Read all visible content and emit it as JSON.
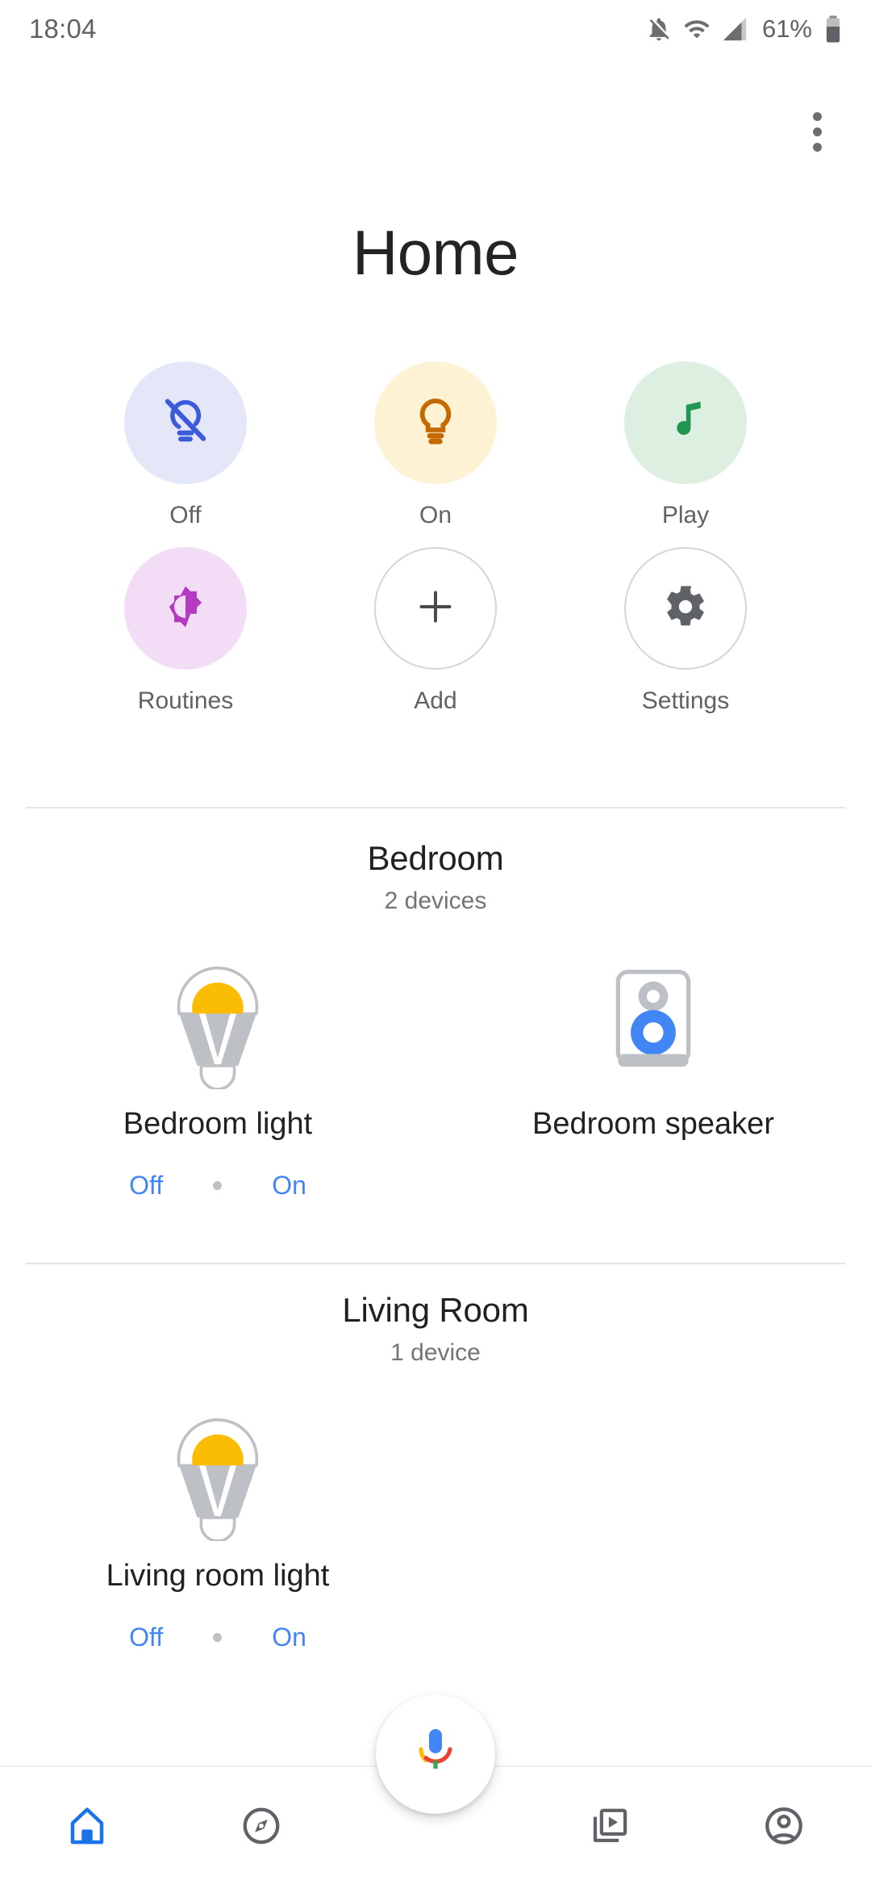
{
  "status_bar": {
    "time": "18:04",
    "battery_percent": "61%",
    "icons": [
      "notifications-off-icon",
      "wifi-icon",
      "cell-signal-icon",
      "battery-icon"
    ]
  },
  "header": {
    "title": "Home",
    "overflow_menu": "more-options"
  },
  "quick_actions": [
    {
      "label": "Off",
      "icon": "lightbulb-off-icon",
      "bg": "#e4e7f7",
      "fg": "#3b5bdb",
      "outlined": false
    },
    {
      "label": "On",
      "icon": "lightbulb-on-icon",
      "bg": "#fdf2d4",
      "fg": "#c56a00",
      "outlined": false
    },
    {
      "label": "Play",
      "icon": "music-note-icon",
      "bg": "#dcefe0",
      "fg": "#219653",
      "outlined": false
    },
    {
      "label": "Routines",
      "icon": "brightness-icon",
      "bg": "#f3dcf6",
      "fg": "#b23bc0",
      "outlined": false
    },
    {
      "label": "Add",
      "icon": "plus-icon",
      "bg": "transparent",
      "fg": "#5f6368",
      "outlined": true
    },
    {
      "label": "Settings",
      "icon": "gear-icon",
      "bg": "transparent",
      "fg": "#5f6368",
      "outlined": true
    }
  ],
  "rooms": [
    {
      "name": "Bedroom",
      "device_count": "2 devices",
      "devices": [
        {
          "name": "Bedroom light",
          "icon": "light-bulb-device-icon",
          "has_controls": true,
          "off_label": "Off",
          "on_label": "On"
        },
        {
          "name": "Bedroom speaker",
          "icon": "speaker-device-icon",
          "has_controls": false,
          "off_label": "",
          "on_label": ""
        }
      ]
    },
    {
      "name": "Living Room",
      "device_count": "1 device",
      "devices": [
        {
          "name": "Living room light",
          "icon": "light-bulb-device-icon",
          "has_controls": true,
          "off_label": "Off",
          "on_label": "On"
        }
      ]
    }
  ],
  "assistant_fab": {
    "icon": "google-assistant-mic-icon"
  },
  "bottom_nav": [
    {
      "name": "home",
      "icon": "home-icon",
      "active": true
    },
    {
      "name": "explore",
      "icon": "compass-icon",
      "active": false
    },
    {
      "name": "media",
      "icon": "media-library-icon",
      "active": false
    },
    {
      "name": "account",
      "icon": "account-circle-icon",
      "active": false
    }
  ],
  "colors": {
    "accent_blue": "#4285f4",
    "text_primary": "#202124",
    "text_secondary": "#5f6368",
    "divider": "#e3e5e7",
    "bulb_yellow": "#fbbc04",
    "bulb_gray": "#bdc1c6",
    "speaker_blue": "#4285f4"
  }
}
